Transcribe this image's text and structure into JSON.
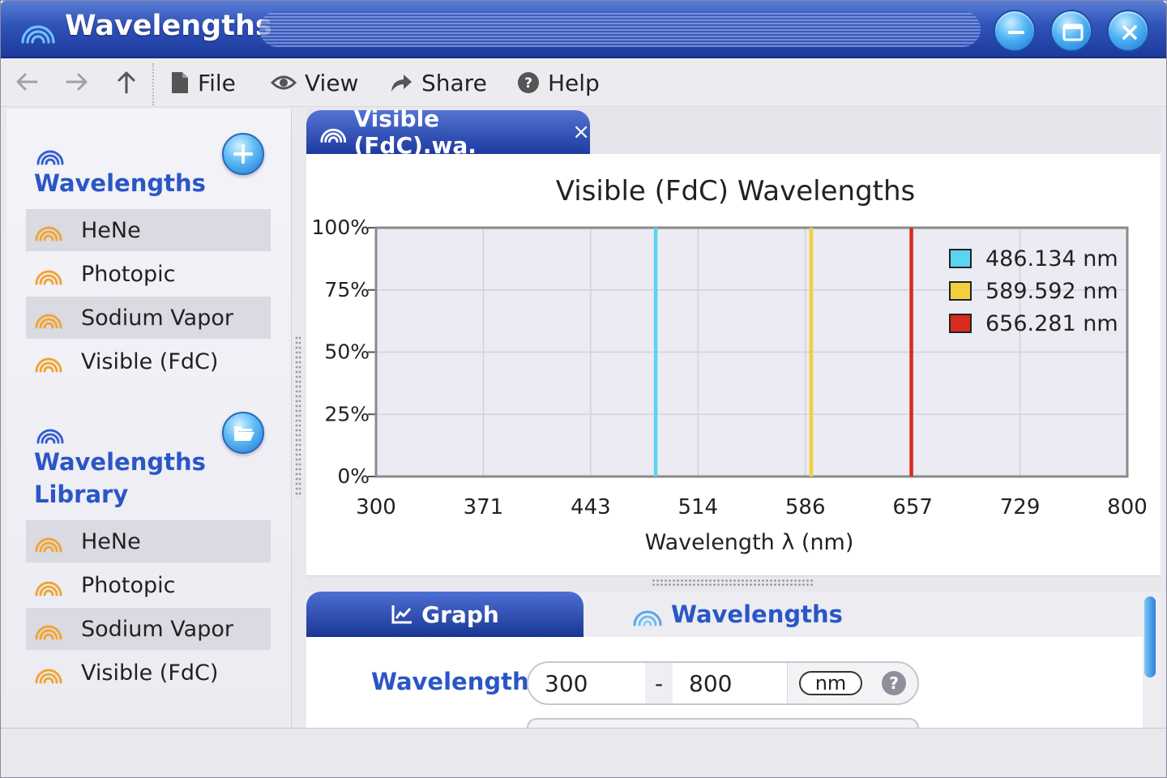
{
  "window": {
    "title": "Wavelengths",
    "controls": [
      "minimize",
      "maximize",
      "close"
    ]
  },
  "toolbar": {
    "nav": [
      "back-arrow",
      "forward-arrow",
      "up-arrow"
    ],
    "menus": [
      {
        "label": "File",
        "icon": "document-icon"
      },
      {
        "label": "View",
        "icon": "eye-icon"
      },
      {
        "label": "Share",
        "icon": "share-icon"
      },
      {
        "label": "Help",
        "icon": "help-icon"
      }
    ]
  },
  "sidebar": {
    "sections": [
      {
        "title": "Wavelengths",
        "action_icon": "plus-icon",
        "items": [
          "HeNe",
          "Photopic",
          "Sodium Vapor",
          "Visible (FdC)"
        ]
      },
      {
        "title_line1": "Wavelengths",
        "title_line2": "Library",
        "action_icon": "folder-open-icon",
        "items": [
          "HeNe",
          "Photopic",
          "Sodium Vapor",
          "Visible (FdC)"
        ]
      }
    ]
  },
  "document_tab": {
    "label": "Visible (FdC).wa.",
    "close": "×"
  },
  "chart_data": {
    "type": "line",
    "title": "Visible (FdC) Wavelengths",
    "xlabel": "Wavelength λ (nm)",
    "ylabel": "",
    "xlim": [
      300,
      800
    ],
    "ylim": [
      0,
      100
    ],
    "x_ticks": [
      "300",
      "371",
      "443",
      "514",
      "586",
      "657",
      "729",
      "800"
    ],
    "y_ticks": [
      "0%",
      "25%",
      "50%",
      "75%",
      "100%"
    ],
    "grid": true,
    "legend_position": "top-right",
    "series": [
      {
        "name": "486.134 nm",
        "x": 486.134,
        "value": 100,
        "color": "#5ad4f0"
      },
      {
        "name": "589.592 nm",
        "x": 589.592,
        "value": 100,
        "color": "#f2cf3c"
      },
      {
        "name": "656.281 nm",
        "x": 656.281,
        "value": 100,
        "color": "#d92b1e"
      }
    ]
  },
  "bottom_tabs": {
    "graph": "Graph",
    "wavelengths": "Wavelengths"
  },
  "form": {
    "label": "Wavelength",
    "min": "300",
    "dash": "-",
    "max": "800",
    "unit": "nm",
    "help": "?"
  },
  "colors": {
    "accent": "#2a56c6",
    "titlebar": "#2f52b8",
    "rainbow_blue": "#3d6fd6",
    "rainbow_orange": "#f0a535"
  }
}
